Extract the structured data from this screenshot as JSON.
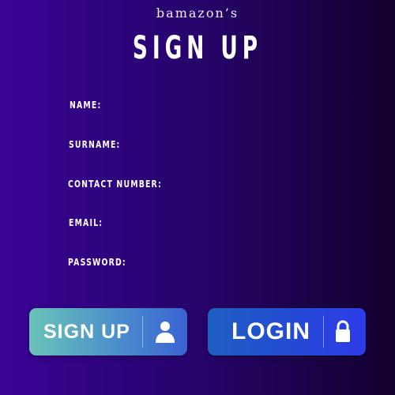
{
  "header": {
    "brand": "bamazon’s",
    "title": "SIGN UP"
  },
  "form": {
    "fields": [
      {
        "label": "NAME:"
      },
      {
        "label": "SURNAME:"
      },
      {
        "label": "CONTACT NUMBER:"
      },
      {
        "label": "EMAIL:"
      },
      {
        "label": "PASSWORD:"
      }
    ]
  },
  "buttons": {
    "signup": {
      "label": "SIGN UP",
      "icon": "user-icon"
    },
    "login": {
      "label": "LOGIN",
      "icon": "lock-icon"
    }
  },
  "colors": {
    "background_left": "#3a0396",
    "background_right": "#12012e",
    "signup_gradient_start": "#6bc3b8",
    "login_gradient": "#2548d6"
  }
}
